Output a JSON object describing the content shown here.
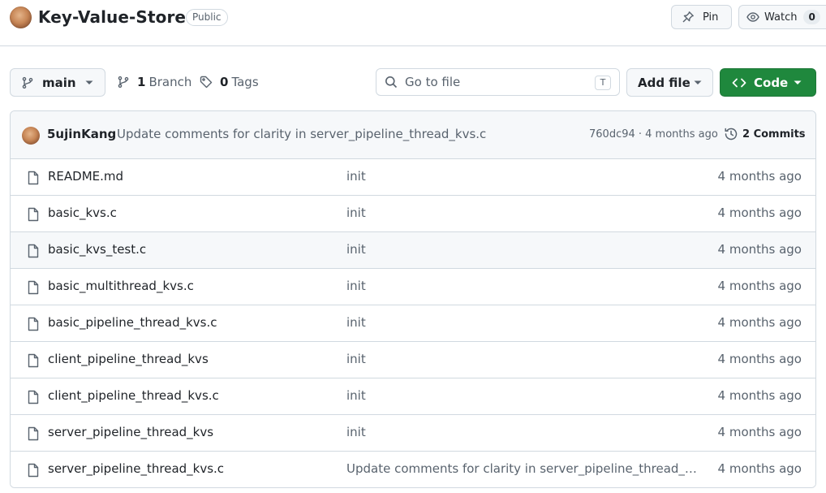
{
  "repo": {
    "name": "Key-Value-Store",
    "visibility": "Public"
  },
  "header_actions": {
    "pin_label": "Pin",
    "watch_label": "Watch",
    "watch_count": "0"
  },
  "toolbar": {
    "branch": "main",
    "branches_count": "1",
    "branches_label": "Branch",
    "tags_count": "0",
    "tags_label": "Tags",
    "search_placeholder": "Go to file",
    "search_shortcut": "T",
    "add_file_label": "Add file",
    "code_label": "Code"
  },
  "latest_commit": {
    "author": "5ujinKang",
    "message": "Update comments for clarity in server_pipeline_thread_kvs.c",
    "meta": "760dc94 · 4 months ago",
    "commits_label": "2 Commits"
  },
  "files": [
    {
      "name": "README.md",
      "message": "init",
      "age": "4 months ago"
    },
    {
      "name": "basic_kvs.c",
      "message": "init",
      "age": "4 months ago"
    },
    {
      "name": "basic_kvs_test.c",
      "message": "init",
      "age": "4 months ago"
    },
    {
      "name": "basic_multithread_kvs.c",
      "message": "init",
      "age": "4 months ago"
    },
    {
      "name": "basic_pipeline_thread_kvs.c",
      "message": "init",
      "age": "4 months ago"
    },
    {
      "name": "client_pipeline_thread_kvs",
      "message": "init",
      "age": "4 months ago"
    },
    {
      "name": "client_pipeline_thread_kvs.c",
      "message": "init",
      "age": "4 months ago"
    },
    {
      "name": "server_pipeline_thread_kvs",
      "message": "init",
      "age": "4 months ago"
    },
    {
      "name": "server_pipeline_thread_kvs.c",
      "message": "Update comments for clarity in server_pipeline_thread_kvs.c",
      "age": "4 months ago"
    }
  ],
  "colors": {
    "primary_button": "#1f883d",
    "border": "#d1d9e0",
    "muted_text": "#59636e"
  }
}
